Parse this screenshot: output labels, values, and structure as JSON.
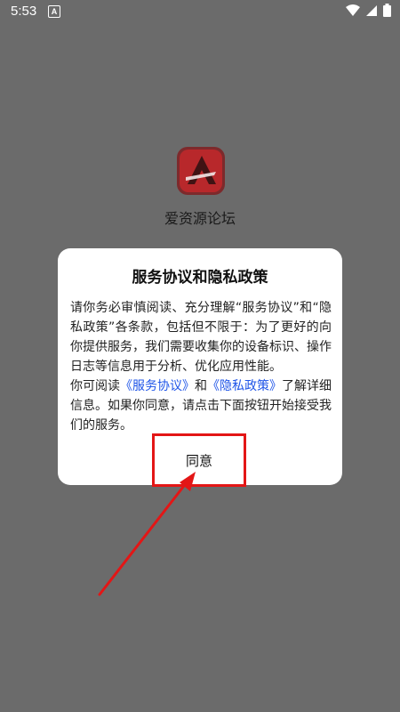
{
  "status_bar": {
    "time": "5:53",
    "notification_badge": "A",
    "icons": [
      "wifi-icon",
      "cellular-icon",
      "battery-icon"
    ]
  },
  "app": {
    "name": "爱资源论坛",
    "logo_icon": "app-logo-icon",
    "logo_color": "#b8282b"
  },
  "dialog": {
    "title": "服务协议和隐私政策",
    "body_intro": "请你务必审慎阅读、充分理解“服务协议”和“隐私政策”各条款，包括但不限于：为了更好的向你提供服务，我们需要收集你的设备标识、操作日志等信息用于分析、优化应用性能。",
    "body_read_prefix": "你可阅读",
    "link_service": "《服务协议》",
    "body_and": "和",
    "link_privacy": "《隐私政策》",
    "body_suffix": "了解详细信息。如果你同意，请点击下面按钮开始接受我们的服务。",
    "agree_label": "同意"
  },
  "colors": {
    "overlay_bg": "#6b6b6b",
    "dialog_bg": "#ffffff",
    "link": "#1f55e8",
    "highlight": "#e31616"
  }
}
